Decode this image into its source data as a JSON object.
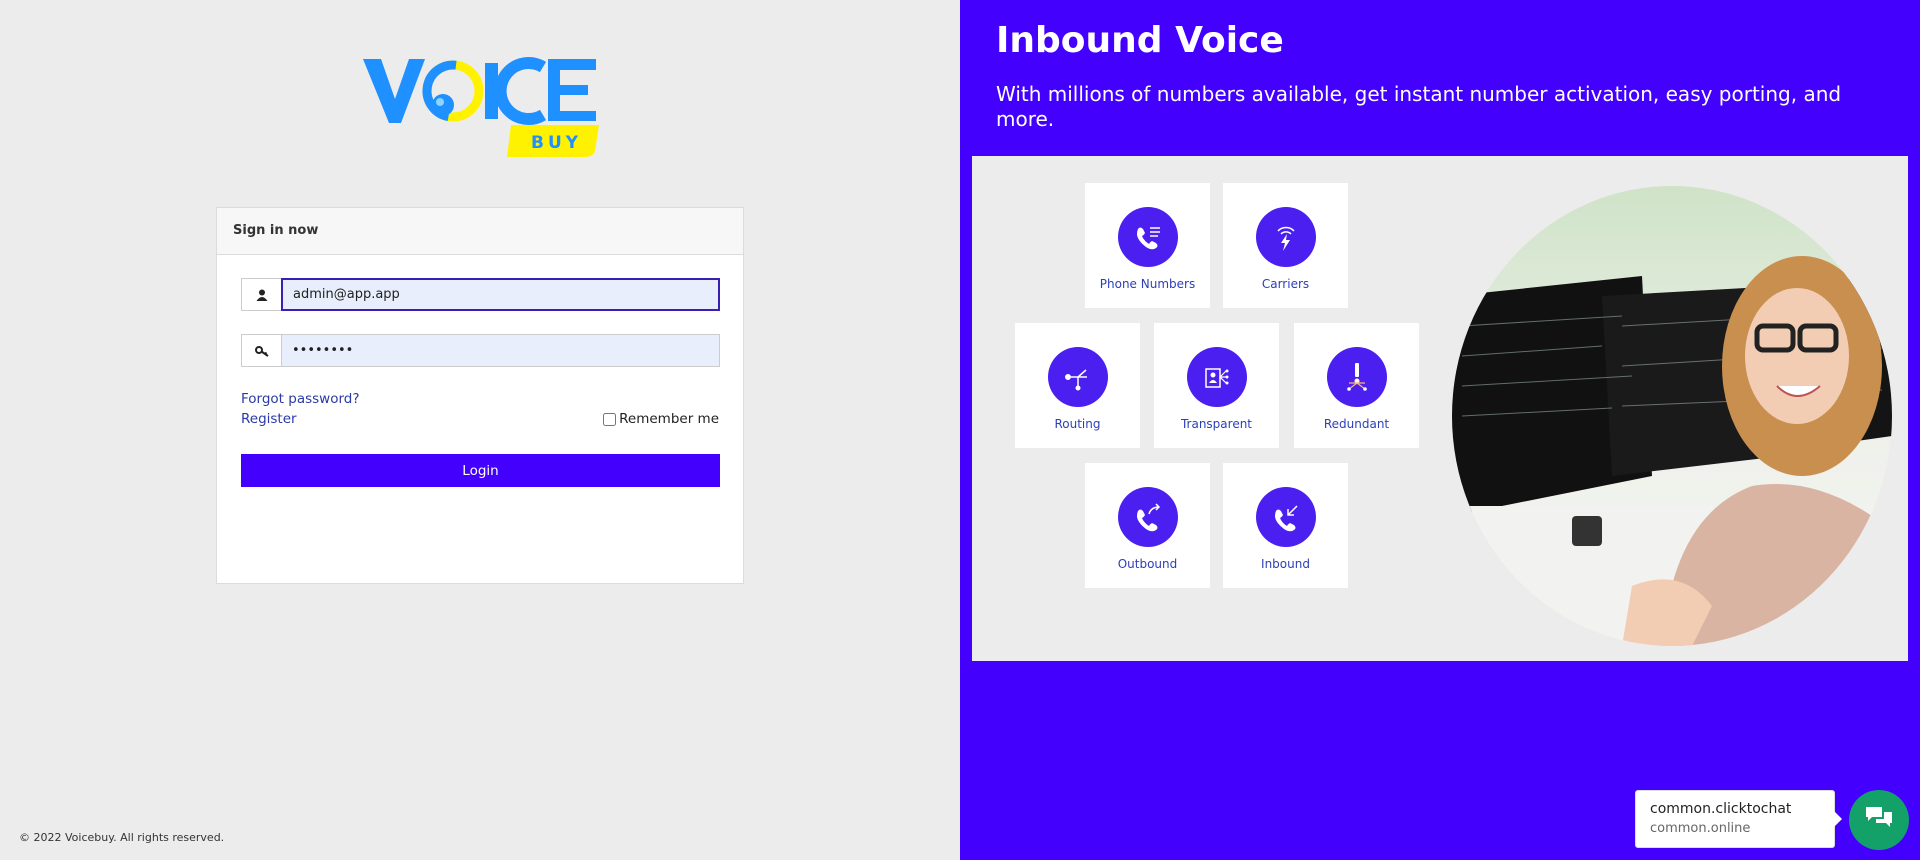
{
  "brand": {
    "logo_text_main": "VOICE",
    "logo_text_sub": "BUY",
    "primary_color": "#4300fd",
    "logo_blue": "#1e90ff",
    "logo_yellow": "#fff200"
  },
  "login": {
    "card_title": "Sign in now",
    "email_value": "admin@app.app",
    "password_value": "password",
    "forgot_label": "Forgot password?",
    "register_label": "Register",
    "remember_label": "Remember me",
    "login_label": "Login"
  },
  "footer": {
    "copyright": "© 2022 Voicebuy. All rights reserved."
  },
  "promo": {
    "title": "Inbound Voice",
    "subtitle": "With millions of numbers available, get instant number activation, easy porting, and more.",
    "features": [
      {
        "label": "Phone Numbers",
        "icon": "phone-list-icon"
      },
      {
        "label": "Carriers",
        "icon": "signal-bolt-icon"
      },
      {
        "label": "Routing",
        "icon": "routing-icon"
      },
      {
        "label": "Transparent",
        "icon": "transparent-icon"
      },
      {
        "label": "Redundant",
        "icon": "redundant-icon"
      },
      {
        "label": "Outbound",
        "icon": "outbound-call-icon"
      },
      {
        "label": "Inbound",
        "icon": "inbound-call-icon"
      }
    ]
  },
  "chat": {
    "title": "common.clicktochat",
    "status": "common.online",
    "icon": "chat-icon",
    "color": "#13a169"
  }
}
